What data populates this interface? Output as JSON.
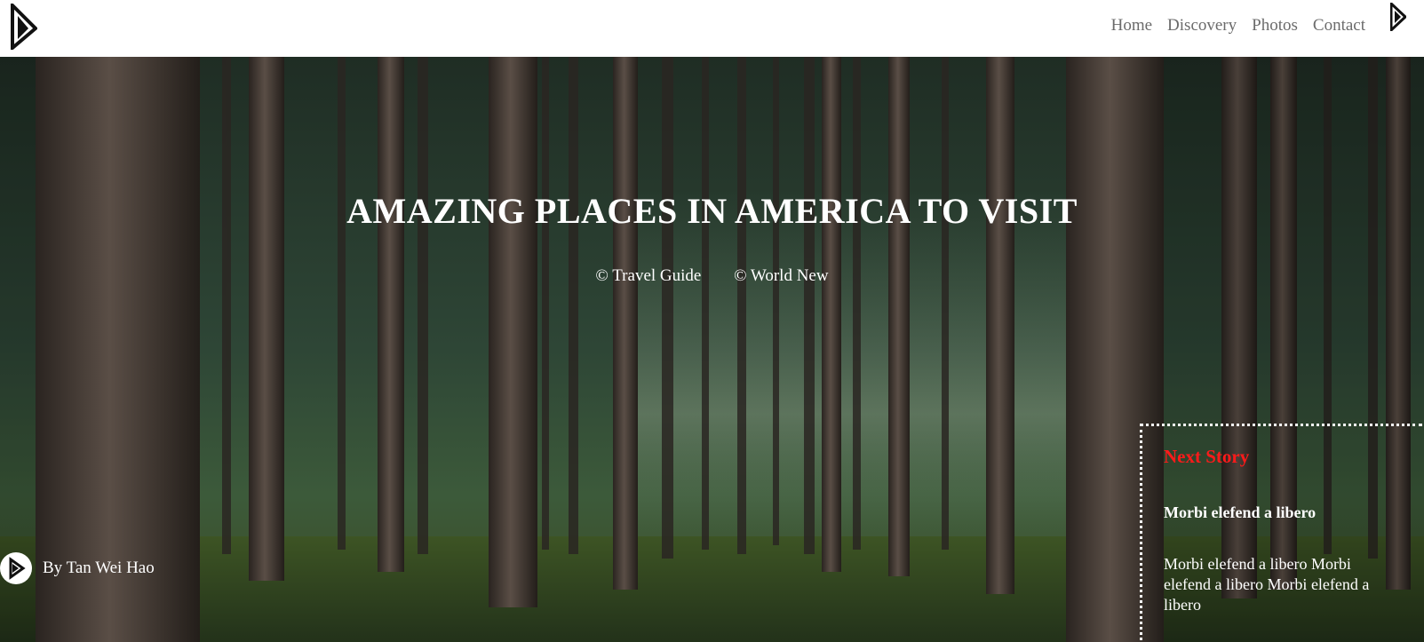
{
  "header": {
    "logo_icon": "brand-logo-icon",
    "nav": [
      {
        "label": "Home"
      },
      {
        "label": "Discovery"
      },
      {
        "label": "Photos"
      },
      {
        "label": "Contact"
      }
    ]
  },
  "hero": {
    "title": "AMAZING PLACES IN AMERICA TO VISIT",
    "tags": [
      "© Travel Guide",
      "© World New"
    ],
    "author": "By Tan Wei Hao"
  },
  "next_story": {
    "label": "Next Story",
    "heading": "Morbi elefend a libero",
    "text": "Morbi elefend a libero Morbi elefend a libero Morbi elefend a libero"
  },
  "colors": {
    "nav_text": "#6b6b6b",
    "next_story_label": "#ff1a1a",
    "header_bg": "#ffffff"
  }
}
